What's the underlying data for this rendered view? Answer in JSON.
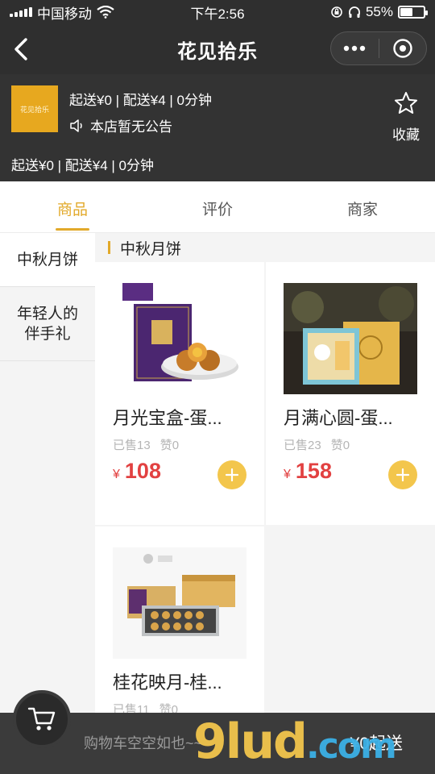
{
  "status_bar": {
    "carrier": "中国移动",
    "time": "下午2:56",
    "battery": "55%",
    "battery_level": 0.55
  },
  "nav": {
    "title": "花见拾乐"
  },
  "shop": {
    "logo_text": "花见拾乐",
    "delivery_info": "起送¥0 | 配送¥4 | 0分钟",
    "notice": "本店暂无公告",
    "delivery_info_2": "起送¥0 | 配送¥4 | 0分钟",
    "favorite_label": "收藏"
  },
  "tabs": [
    {
      "label": "商品"
    },
    {
      "label": "评价"
    },
    {
      "label": "商家"
    }
  ],
  "categories": [
    {
      "label": "中秋月饼"
    },
    {
      "label": "年轻人的伴手礼"
    }
  ],
  "section_title": "中秋月饼",
  "products": [
    {
      "name": "月光宝盒-蛋...",
      "sold": "已售13",
      "likes": "赞0",
      "currency": "¥",
      "price": "108"
    },
    {
      "name": "月满心圆-蛋...",
      "sold": "已售23",
      "likes": "赞0",
      "currency": "¥",
      "price": "158"
    },
    {
      "name": "桂花映月-桂...",
      "sold": "已售11",
      "likes": "赞0"
    }
  ],
  "cart": {
    "empty_text": "购物车空空如也~~",
    "min_order": "¥0起送"
  },
  "watermark": {
    "text": "9lud",
    "suffix": ".com"
  },
  "colors": {
    "accent": "#e2a92a",
    "price": "#e24141",
    "add_button": "#f3c64c",
    "dark_bg": "#2f2f2f"
  }
}
